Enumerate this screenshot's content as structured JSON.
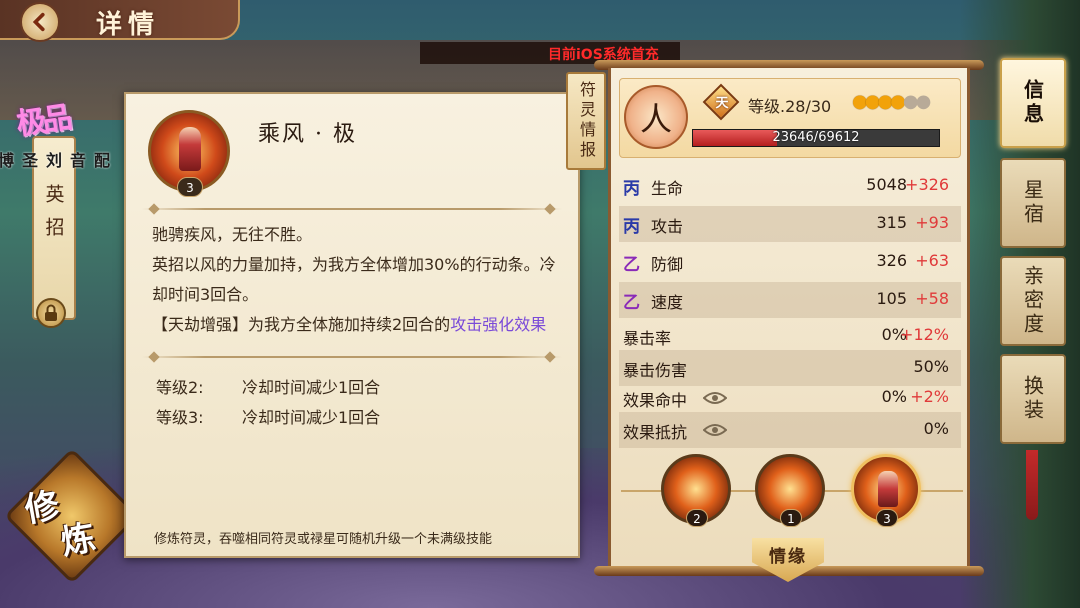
{
  "header": {
    "title": "详情",
    "ticker": "目前iOS系统首充"
  },
  "left": {
    "quality": "极品",
    "skill_tab": "英招",
    "voice": [
      "配",
      "音",
      "刘",
      "圣",
      "博"
    ],
    "cultivate_btn": [
      "修",
      "炼"
    ]
  },
  "skill": {
    "name": "乘风 · 极",
    "icon_level": "3",
    "desc_lines": [
      "驰骋疾风，无往不胜。",
      "英招以风的力量加持，为我方全体增加30%的行动条。冷却时间3回合。"
    ],
    "desc_enhance_prefix": "【天劫增强】为我方全体施加持续2回合的",
    "desc_enhance_link": "攻击强化效果",
    "levels": [
      {
        "label": "等级2:",
        "effect": "冷却时间减少1回合"
      },
      {
        "label": "等级3:",
        "effect": "冷却时间减少1回合"
      }
    ],
    "cultivate_hint": "修炼符灵，吞噬相同符灵或禄星可随机升级一个未满级技能"
  },
  "fuling_tab": "符灵情报",
  "profile": {
    "type_char": "人",
    "grade": "天",
    "level_text": "等级.28/30",
    "stars_filled": 4,
    "stars_total": 6,
    "exp_text": "23646/69612",
    "exp_current": 23646,
    "exp_max": 69612
  },
  "stats": [
    {
      "grade": "丙",
      "grade_color": "#2a3aa8",
      "name": "生命",
      "value": "5048",
      "add": "+326"
    },
    {
      "grade": "丙",
      "grade_color": "#2a3aa8",
      "name": "攻击",
      "value": "315",
      "add": "+93"
    },
    {
      "grade": "乙",
      "grade_color": "#8a2ab8",
      "name": "防御",
      "value": "326",
      "add": "+63"
    },
    {
      "grade": "乙",
      "grade_color": "#8a2ab8",
      "name": "速度",
      "value": "105",
      "add": "+58"
    }
  ],
  "extra_stats": [
    {
      "name": "暴击率",
      "value": "0%",
      "add": "+12%"
    },
    {
      "name": "暴击伤害",
      "value": "50%",
      "add": ""
    },
    {
      "name": "效果命中",
      "value": "0%",
      "add": "+2%"
    },
    {
      "name": "效果抵抗",
      "value": "0%",
      "add": ""
    }
  ],
  "skills_bar": {
    "orbs": [
      "2",
      "1",
      "3"
    ],
    "qingyuan": "情缘"
  },
  "side_tabs": [
    "信息",
    "星宿",
    "亲密度",
    "换装"
  ]
}
